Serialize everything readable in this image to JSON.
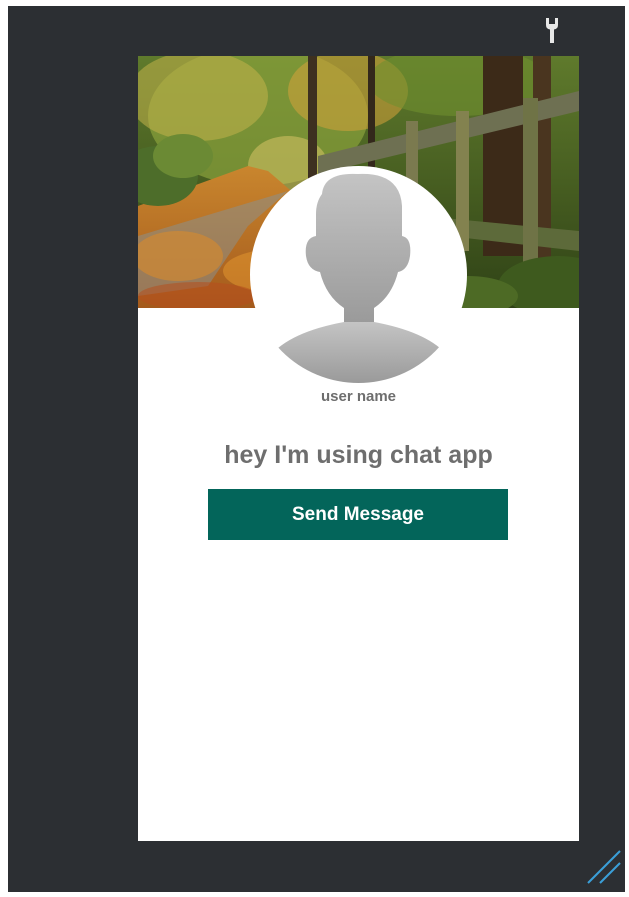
{
  "profile": {
    "username": "user name",
    "status": "hey I'm using chat app",
    "send_label": "Send Message"
  },
  "icons": {
    "toolbar": "wrench-icon",
    "avatar": "person-silhouette-icon",
    "resize": "resize-handle-icon"
  },
  "colors": {
    "editor_background": "#2c2f33",
    "card_background": "#ffffff",
    "button_background": "#03655a",
    "button_text": "#ffffff",
    "secondary_text": "#6e6e6e"
  }
}
